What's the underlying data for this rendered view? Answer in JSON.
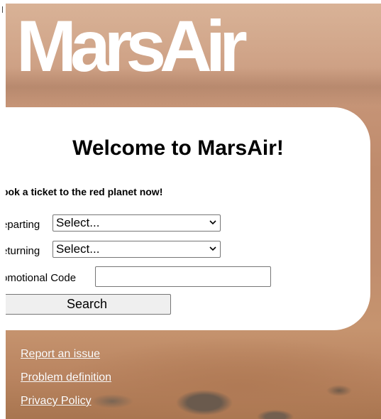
{
  "header": {
    "logo_text": "MarsAir"
  },
  "welcome": {
    "title": "Welcome to MarsAir!",
    "subtitle": "ook a ticket to the red planet now!"
  },
  "form": {
    "departing_label": "eparting",
    "departing_value": "Select...",
    "returning_label": "eturning",
    "returning_value": "Select...",
    "promo_label": "omotional Code",
    "promo_value": "",
    "search_label": "Search"
  },
  "footer": {
    "links": [
      {
        "label": "Report an issue"
      },
      {
        "label": "Problem definition"
      },
      {
        "label": "Privacy Policy"
      }
    ]
  },
  "colors": {
    "sky": "#cfa182",
    "ground": "#b98460",
    "card": "#ffffff",
    "button": "#efefef"
  },
  "icons": {
    "select_arrow": "chevron-down-icon"
  }
}
